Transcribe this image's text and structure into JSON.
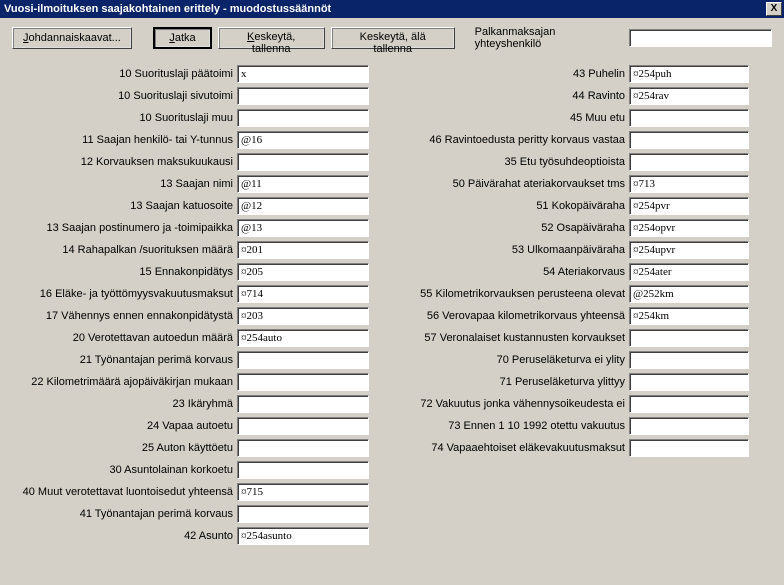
{
  "title": "Vuosi-ilmoituksen saajakohtainen erittely - muodostussäännöt",
  "close": "X",
  "toolbar": {
    "johdannais": "Johdannaiskaavat...",
    "jatka": "Jatka",
    "keskeyta_tallenna": "Keskeytä, tallenna",
    "keskeyta_ala": "Keskeytä, älä tallenna",
    "contact_label": "Palkanmaksajan yhteyshenkilö",
    "contact_value": ""
  },
  "left": [
    {
      "label": "10 Suorituslaji päätoimi",
      "value": "x"
    },
    {
      "label": "10 Suorituslaji sivutoimi",
      "value": ""
    },
    {
      "label": "10 Suorituslaji muu",
      "value": ""
    },
    {
      "label": "11 Saajan henkilö- tai Y-tunnus",
      "value": "@16"
    },
    {
      "label": "12 Korvauksen maksukuukausi",
      "value": ""
    },
    {
      "label": "13 Saajan nimi",
      "value": "@11"
    },
    {
      "label": "13 Saajan katuosoite",
      "value": "@12"
    },
    {
      "label": "13 Saajan postinumero ja -toimipaikka",
      "value": "@13"
    },
    {
      "label": "14 Rahapalkan /suorituksen määrä",
      "value": "¤201"
    },
    {
      "label": "15 Ennakonpidätys",
      "value": "¤205"
    },
    {
      "label": "16 Eläke- ja työttömyysvakuutusmaksut",
      "value": "¤714"
    },
    {
      "label": "17 Vähennys ennen ennakonpidätystä",
      "value": "¤203"
    },
    {
      "label": "20 Verotettavan autoedun määrä",
      "value": "¤254auto"
    },
    {
      "label": "21 Työnantajan perimä korvaus",
      "value": ""
    },
    {
      "label": "22 Kilometrimäärä ajopäiväkirjan mukaan",
      "value": ""
    },
    {
      "label": "23 Ikäryhmä",
      "value": ""
    },
    {
      "label": "24 Vapaa autoetu",
      "value": ""
    },
    {
      "label": "25 Auton käyttöetu",
      "value": ""
    },
    {
      "label": "30 Asuntolainan korkoetu",
      "value": ""
    },
    {
      "label": "40 Muut verotettavat luontoisedut yhteensä",
      "value": "¤715"
    },
    {
      "label": "41 Työnantajan perimä korvaus",
      "value": ""
    },
    {
      "label": "42 Asunto",
      "value": "¤254asunto"
    }
  ],
  "right": [
    {
      "label": "43 Puhelin",
      "value": "¤254puh"
    },
    {
      "label": "44 Ravinto",
      "value": "¤254rav"
    },
    {
      "label": "45 Muu etu",
      "value": ""
    },
    {
      "label": "46 Ravintoedusta peritty korvaus vastaa",
      "value": ""
    },
    {
      "label": "35 Etu työsuhdeoptioista",
      "value": ""
    },
    {
      "label": "50 Päivärahat ateriakorvaukset tms",
      "value": "¤713"
    },
    {
      "label": "51 Kokopäiväraha",
      "value": "¤254pvr"
    },
    {
      "label": "52 Osapäiväraha",
      "value": "¤254opvr"
    },
    {
      "label": "53 Ulkomaanpäiväraha",
      "value": "¤254upvr"
    },
    {
      "label": "54 Ateriakorvaus",
      "value": "¤254ater"
    },
    {
      "label": "55 Kilometrikorvauksen perusteena olevat",
      "value": "@252km"
    },
    {
      "label": "56 Verovapaa kilometrikorvaus yhteensä",
      "value": "¤254km"
    },
    {
      "label": "57 Veronalaiset kustannusten korvaukset",
      "value": ""
    },
    {
      "label": "70 Peruseläketurva ei ylity",
      "value": ""
    },
    {
      "label": "71 Peruseläketurva ylittyy",
      "value": ""
    },
    {
      "label": "72 Vakuutus jonka vähennysoikeudesta ei",
      "value": ""
    },
    {
      "label": "73 Ennen 1 10 1992 otettu vakuutus",
      "value": ""
    },
    {
      "label": "74 Vapaaehtoiset eläkevakuutusmaksut",
      "value": ""
    }
  ]
}
